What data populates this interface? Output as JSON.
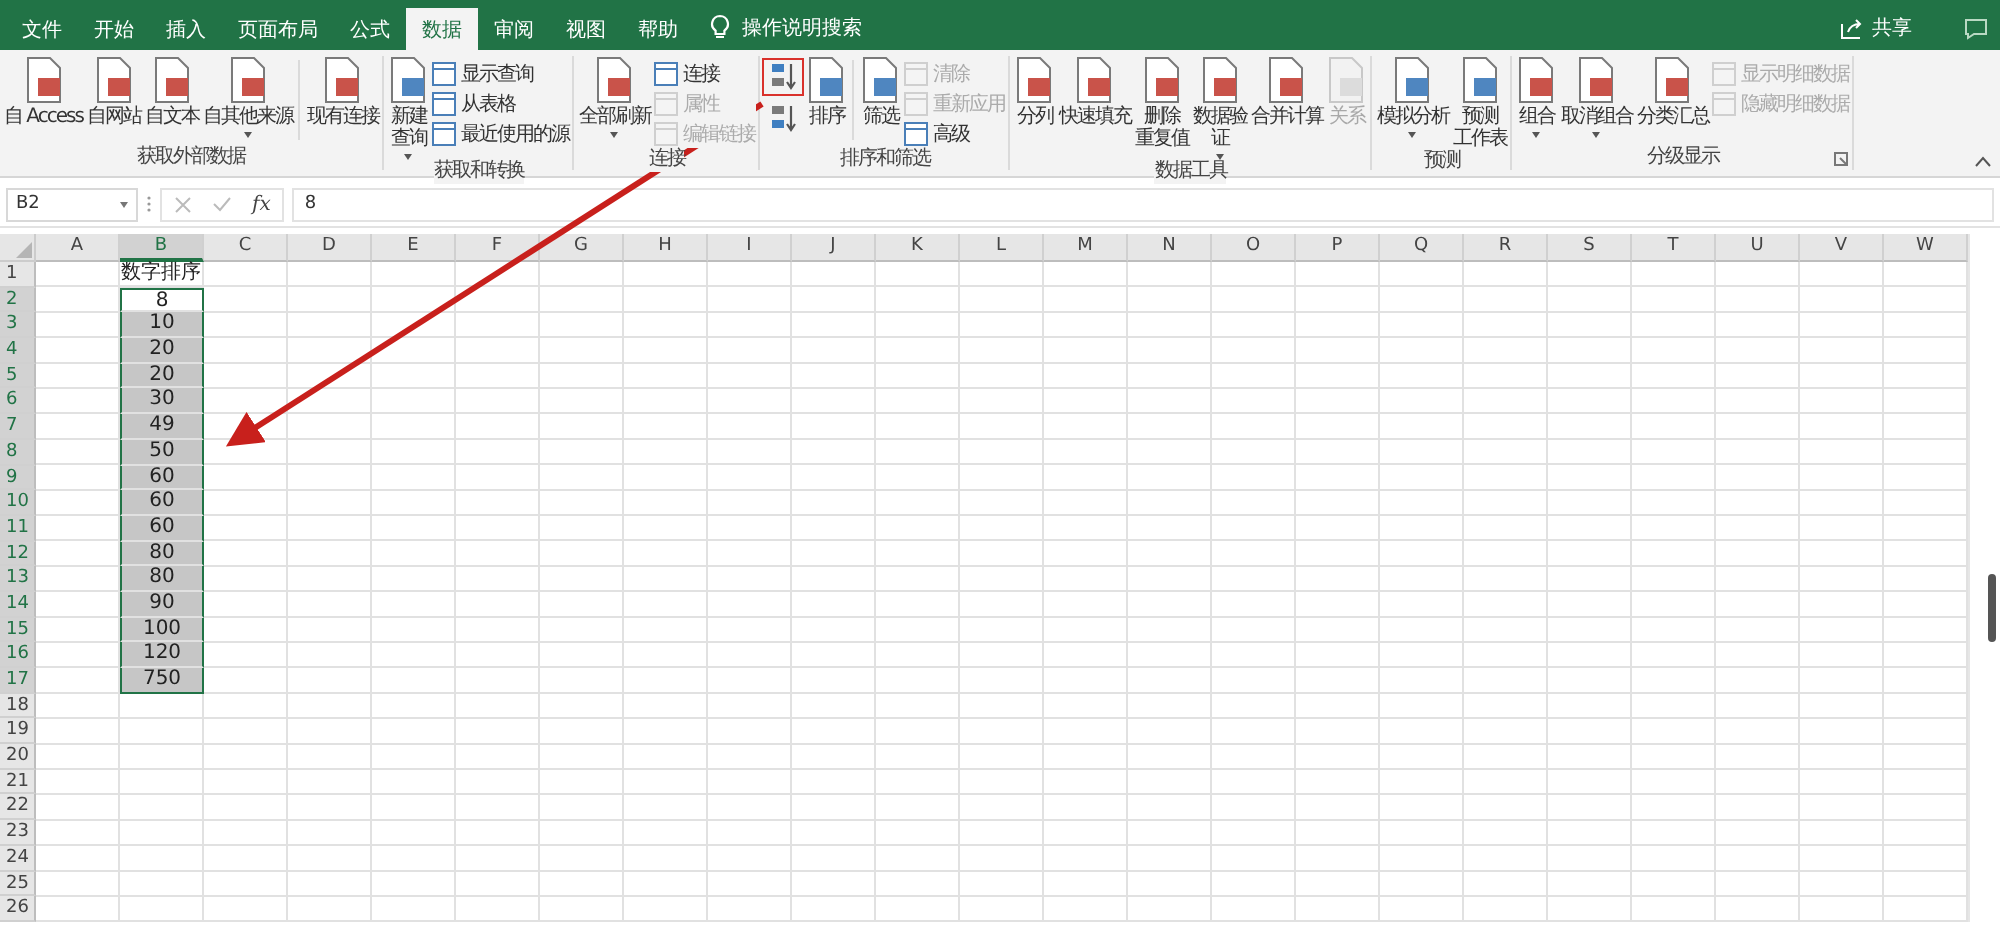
{
  "tabs": [
    {
      "label": "文件",
      "selected": false
    },
    {
      "label": "开始",
      "selected": false
    },
    {
      "label": "插入",
      "selected": false
    },
    {
      "label": "页面布局",
      "selected": false
    },
    {
      "label": "公式",
      "selected": false
    },
    {
      "label": "数据",
      "selected": true
    },
    {
      "label": "审阅",
      "selected": false
    },
    {
      "label": "视图",
      "selected": false
    },
    {
      "label": "帮助",
      "selected": false
    }
  ],
  "search": {
    "label": "操作说明搜索"
  },
  "share": {
    "label": "共享"
  },
  "ribbon": [
    {
      "title": "获取外部数据",
      "columns": [
        {
          "kind": "large",
          "lines": [
            "自 Access"
          ],
          "disabled": false
        },
        {
          "kind": "large",
          "lines": [
            "自网站"
          ],
          "disabled": false
        },
        {
          "kind": "large",
          "lines": [
            "自文本"
          ],
          "disabled": false
        },
        {
          "kind": "large",
          "lines": [
            "自其他来源"
          ],
          "dropdown": true,
          "disabled": false
        },
        {
          "kind": "separator"
        },
        {
          "kind": "large",
          "lines": [
            "现有连接"
          ],
          "disabled": false
        }
      ]
    },
    {
      "title": "获取和转换",
      "columns": [
        {
          "kind": "large",
          "lines": [
            "新建",
            "查询"
          ],
          "dropdown": true,
          "disabled": false
        },
        {
          "kind": "stack",
          "items": [
            {
              "kind": "small",
              "label": "显示查询",
              "disabled": false
            },
            {
              "kind": "small",
              "label": "从表格",
              "disabled": false
            },
            {
              "kind": "small",
              "label": "最近使用的源",
              "disabled": false
            }
          ]
        }
      ]
    },
    {
      "title": "连接",
      "columns": [
        {
          "kind": "large",
          "lines": [
            "全部刷新"
          ],
          "dropdown": true,
          "disabled": false
        },
        {
          "kind": "stack",
          "items": [
            {
              "kind": "small",
              "label": "连接",
              "disabled": false
            },
            {
              "kind": "small",
              "label": "属性",
              "disabled": true
            },
            {
              "kind": "small",
              "label": "编辑链接",
              "disabled": true
            }
          ]
        }
      ]
    },
    {
      "title": "排序和筛选",
      "columns": [
        {
          "kind": "stack",
          "items": [
            {
              "kind": "sort-ascending",
              "highlighted": true
            },
            {
              "kind": "sort-descending",
              "highlighted": false
            }
          ]
        },
        {
          "kind": "large",
          "lines": [
            "排序"
          ],
          "disabled": false
        },
        {
          "kind": "separator"
        },
        {
          "kind": "large",
          "lines": [
            "筛选"
          ],
          "disabled": false
        },
        {
          "kind": "stack",
          "items": [
            {
              "kind": "small",
              "label": "清除",
              "disabled": true
            },
            {
              "kind": "small",
              "label": "重新应用",
              "disabled": true
            },
            {
              "kind": "small",
              "label": "高级",
              "disabled": false
            }
          ]
        }
      ]
    },
    {
      "title": "数据工具",
      "columns": [
        {
          "kind": "large",
          "lines": [
            "分列"
          ],
          "disabled": false
        },
        {
          "kind": "large",
          "lines": [
            "快速填充"
          ],
          "disabled": false
        },
        {
          "kind": "large",
          "lines": [
            "删除",
            "重复值"
          ],
          "disabled": false
        },
        {
          "kind": "large",
          "lines": [
            "数据验",
            "证"
          ],
          "dropdown": true,
          "disabled": false
        },
        {
          "kind": "large",
          "lines": [
            "合并计算"
          ],
          "disabled": false
        },
        {
          "kind": "large",
          "lines": [
            "关系"
          ],
          "disabled": true
        }
      ]
    },
    {
      "title": "预测",
      "columns": [
        {
          "kind": "large",
          "lines": [
            "模拟分析"
          ],
          "dropdown": true,
          "disabled": false
        },
        {
          "kind": "large",
          "lines": [
            "预测",
            "工作表"
          ],
          "disabled": false
        }
      ]
    },
    {
      "title": "分级显示",
      "launcher": true,
      "columns": [
        {
          "kind": "large",
          "lines": [
            "组合"
          ],
          "dropdown": true,
          "disabled": false
        },
        {
          "kind": "large",
          "lines": [
            "取消组合"
          ],
          "dropdown": true,
          "disabled": false
        },
        {
          "kind": "large",
          "lines": [
            "分类汇总"
          ],
          "disabled": false
        },
        {
          "kind": "stack",
          "items": [
            {
              "kind": "small",
              "label": "显示明细数据",
              "disabled": true
            },
            {
              "kind": "small",
              "label": "隐藏明细数据",
              "disabled": true
            }
          ]
        }
      ]
    }
  ],
  "formula_bar": {
    "name_box": "B2",
    "function_label": "fx",
    "value": "8"
  },
  "columns": [
    {
      "label": "A",
      "selected": false
    },
    {
      "label": "B",
      "selected": true
    },
    {
      "label": "C",
      "selected": false
    },
    {
      "label": "D",
      "selected": false
    },
    {
      "label": "E",
      "selected": false
    },
    {
      "label": "F",
      "selected": false
    },
    {
      "label": "G",
      "selected": false
    },
    {
      "label": "H",
      "selected": false
    },
    {
      "label": "I",
      "selected": false
    },
    {
      "label": "J",
      "selected": false
    },
    {
      "label": "K",
      "selected": false
    },
    {
      "label": "L",
      "selected": false
    },
    {
      "label": "M",
      "selected": false
    },
    {
      "label": "N",
      "selected": false
    },
    {
      "label": "O",
      "selected": false
    },
    {
      "label": "P",
      "selected": false
    },
    {
      "label": "Q",
      "selected": false
    },
    {
      "label": "R",
      "selected": false
    },
    {
      "label": "S",
      "selected": false
    },
    {
      "label": "T",
      "selected": false
    },
    {
      "label": "U",
      "selected": false
    },
    {
      "label": "V",
      "selected": false
    },
    {
      "label": "W",
      "selected": false
    }
  ],
  "rows": [
    {
      "header": "1",
      "column_b": "数字排序",
      "selected": false
    },
    {
      "header": "2",
      "column_b": "8",
      "selected": true,
      "active": true
    },
    {
      "header": "3",
      "column_b": "10",
      "selected": true
    },
    {
      "header": "4",
      "column_b": "20",
      "selected": true
    },
    {
      "header": "5",
      "column_b": "20",
      "selected": true
    },
    {
      "header": "6",
      "column_b": "30",
      "selected": true
    },
    {
      "header": "7",
      "column_b": "49",
      "selected": true
    },
    {
      "header": "8",
      "column_b": "50",
      "selected": true
    },
    {
      "header": "9",
      "column_b": "60",
      "selected": true
    },
    {
      "header": "10",
      "column_b": "60",
      "selected": true
    },
    {
      "header": "11",
      "column_b": "60",
      "selected": true
    },
    {
      "header": "12",
      "column_b": "80",
      "selected": true
    },
    {
      "header": "13",
      "column_b": "80",
      "selected": true
    },
    {
      "header": "14",
      "column_b": "90",
      "selected": true
    },
    {
      "header": "15",
      "column_b": "100",
      "selected": true
    },
    {
      "header": "16",
      "column_b": "120",
      "selected": true
    },
    {
      "header": "17",
      "column_b": "750",
      "selected": true
    },
    {
      "header": "18",
      "selected": false
    },
    {
      "header": "19",
      "selected": false
    },
    {
      "header": "20",
      "selected": false
    },
    {
      "header": "21",
      "selected": false
    },
    {
      "header": "22",
      "selected": false
    },
    {
      "header": "23",
      "selected": false
    },
    {
      "header": "24",
      "selected": false
    },
    {
      "header": "25",
      "selected": false
    },
    {
      "header": "26",
      "selected": false
    }
  ]
}
